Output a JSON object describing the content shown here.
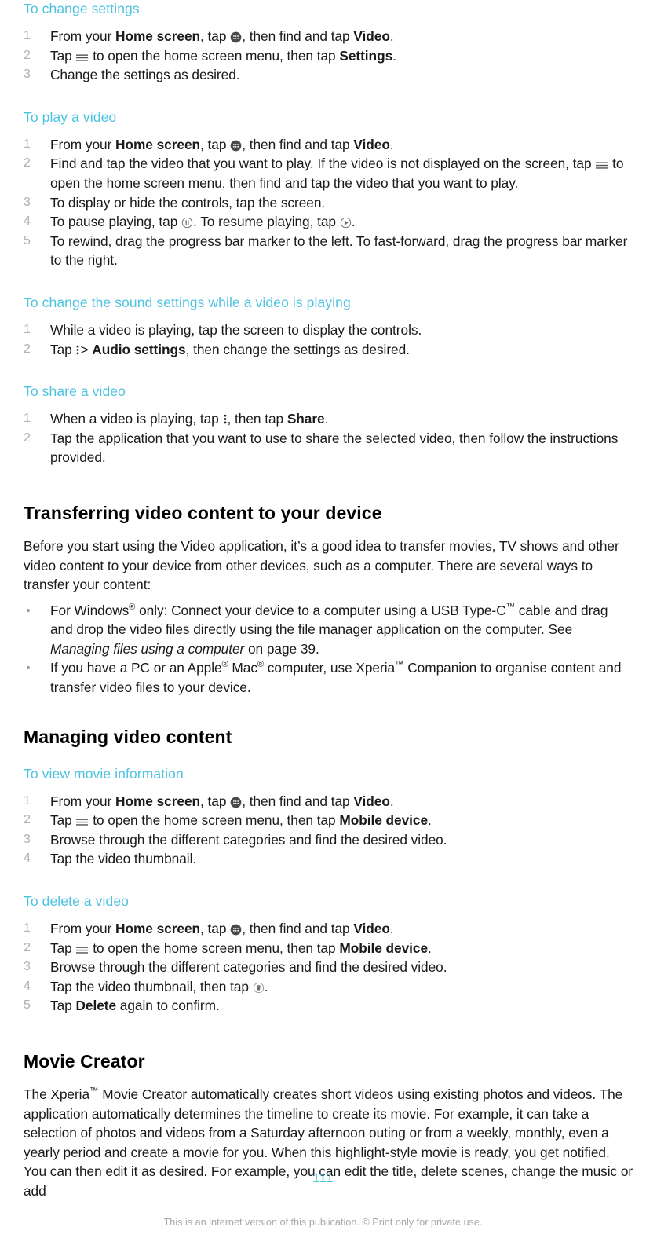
{
  "document": {
    "page_number": "111",
    "footer_note": "This is an internet version of this publication. © Print only for private use.",
    "accent_color": "#4ec3e0",
    "body_color": "#1a1a1a",
    "list_marker_color": "#b0b0b0"
  },
  "sections": {
    "change_settings": {
      "heading": "To change settings",
      "steps": [
        {
          "pre": "From your ",
          "b1": "Home screen",
          "mid": ", tap ",
          "icon": "app-drawer-icon",
          "mid2": ", then find and tap ",
          "b2": "Video",
          "post": "."
        },
        {
          "pre": "Tap ",
          "icon": "hamburger-menu-icon",
          "mid": " to open the home screen menu, then tap ",
          "b2": "Settings",
          "post": "."
        },
        {
          "text": "Change the settings as desired."
        }
      ]
    },
    "play_video": {
      "heading": "To play a video",
      "steps": [
        {
          "pre": "From your ",
          "b1": "Home screen",
          "mid": ", tap ",
          "icon": "app-drawer-icon",
          "mid2": ", then find and tap ",
          "b2": "Video",
          "post": "."
        },
        {
          "pre": "Find and tap the video that you want to play. If the video is not displayed on the screen, tap ",
          "icon": "hamburger-menu-icon",
          "mid": " to open the home screen menu, then find and tap the video that you want to play."
        },
        {
          "text": "To display or hide the controls, tap the screen."
        },
        {
          "pre": "To pause playing, tap ",
          "icon": "pause-circle-icon",
          "mid": ". To resume playing, tap ",
          "icon2": "play-circle-icon",
          "post": "."
        },
        {
          "text": "To rewind, drag the progress bar marker to the left. To fast-forward, drag the progress bar marker to the right."
        }
      ]
    },
    "sound_settings": {
      "heading": "To change the sound settings while a video is playing",
      "steps": [
        {
          "text": "While a video is playing, tap the screen to display the controls."
        },
        {
          "pre": "Tap ",
          "icon": "overflow-menu-icon",
          "mid": "> ",
          "b2": "Audio settings",
          "post": ", then change the settings as desired."
        }
      ]
    },
    "share_video": {
      "heading": "To share a video",
      "steps": [
        {
          "pre": "When a video is playing, tap ",
          "icon": "overflow-menu-icon",
          "mid": ", then tap ",
          "b2": "Share",
          "post": "."
        },
        {
          "text": "Tap the application that you want to use to share the selected video, then follow the instructions provided."
        }
      ]
    },
    "transferring": {
      "heading": "Transferring video content to your device",
      "intro": "Before you start using the Video application, it’s a good idea to transfer movies, TV shows and other video content to your device from other devices, such as a computer. There are several ways to transfer your content:",
      "bullets": [
        {
          "p1": "For Windows",
          "sup1": "®",
          "p2": " only: Connect your device to a computer using a USB Type-C",
          "tm1": "™",
          "p3": " cable and drag and drop the video files directly using the file manager application on the computer. See ",
          "italic": "Managing files using a computer",
          "p4": " on page 39."
        },
        {
          "p1": "If you have a PC or an Apple",
          "sup1": "®",
          "p2": " Mac",
          "sup2": "®",
          "p3": " computer, use Xperia",
          "tm1": "™",
          "p4": " Companion to organise content and transfer video files to your device."
        }
      ]
    },
    "managing": {
      "heading": "Managing video content"
    },
    "view_movie_info": {
      "heading": "To view movie information",
      "steps": [
        {
          "pre": "From your ",
          "b1": "Home screen",
          "mid": ", tap ",
          "icon": "app-drawer-icon",
          "mid2": ", then find and tap ",
          "b2": "Video",
          "post": "."
        },
        {
          "pre": "Tap ",
          "icon": "hamburger-menu-icon",
          "mid": " to open the home screen menu, then tap ",
          "b2": "Mobile device",
          "post": "."
        },
        {
          "text": "Browse through the different categories and find the desired video."
        },
        {
          "text": "Tap the video thumbnail."
        }
      ]
    },
    "delete_video": {
      "heading": "To delete a video",
      "steps": [
        {
          "pre": "From your ",
          "b1": "Home screen",
          "mid": ", tap ",
          "icon": "app-drawer-icon",
          "mid2": ", then find and tap ",
          "b2": "Video",
          "post": "."
        },
        {
          "pre": "Tap ",
          "icon": "hamburger-menu-icon",
          "mid": " to open the home screen menu, then tap ",
          "b2": "Mobile device",
          "post": "."
        },
        {
          "text": "Browse through the different categories and find the desired video."
        },
        {
          "pre": "Tap the video thumbnail, then tap ",
          "icon": "trash-circle-icon",
          "post": "."
        },
        {
          "pre": "Tap ",
          "b2": "Delete",
          "post": " again to confirm."
        }
      ]
    },
    "movie_creator": {
      "heading": "Movie Creator",
      "paragraph_pre": "The Xperia",
      "paragraph_tm": "™",
      "paragraph_post": " Movie Creator automatically creates short videos using existing photos and videos. The application automatically determines the timeline to create its movie. For example, it can take a selection of photos and videos from a Saturday afternoon outing or from a weekly, monthly, even a yearly period and create a movie for you. When this highlight-style movie is ready, you get notified. You can then edit it as desired. For example, you can edit the title, delete scenes, change the music or add"
    }
  }
}
